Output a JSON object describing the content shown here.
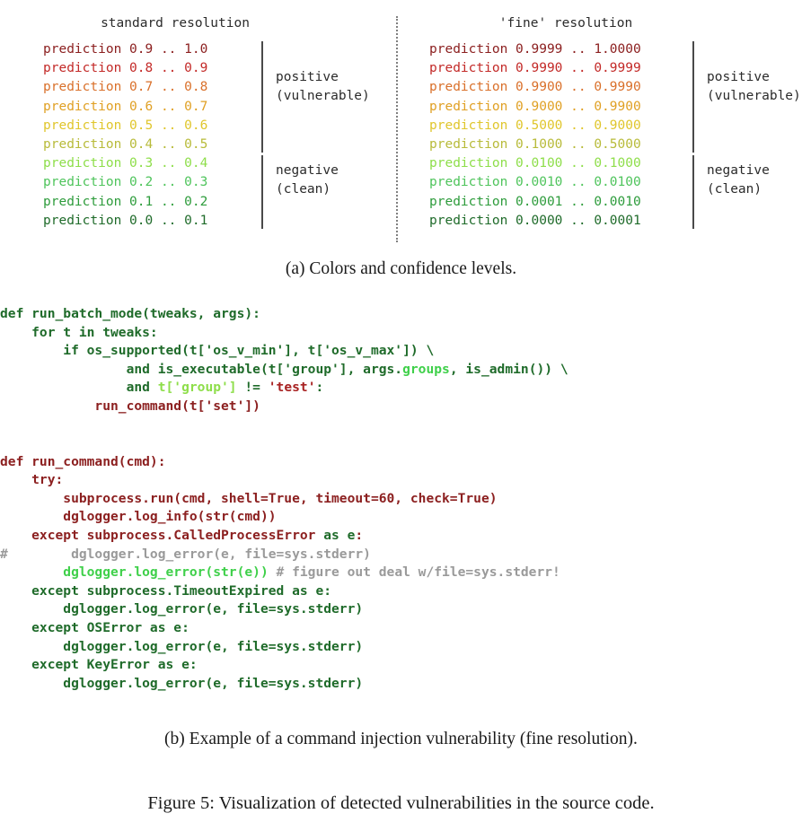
{
  "figure": {
    "caption_a": "(a) Colors and confidence levels.",
    "caption_b": "(b) Example of a command injection vulnerability (fine resolution).",
    "caption_figure": "Figure 5: Visualization of detected vulnerabilities in the source code."
  },
  "legend": {
    "standard": {
      "title": "standard resolution",
      "rows": [
        {
          "text": "prediction 0.9 .. 1.0",
          "color": "#8c2020"
        },
        {
          "text": "prediction 0.8 .. 0.9",
          "color": "#c32a28"
        },
        {
          "text": "prediction 0.7 .. 0.8",
          "color": "#d9702a"
        },
        {
          "text": "prediction 0.6 .. 0.7",
          "color": "#e0a024"
        },
        {
          "text": "prediction 0.5 .. 0.6",
          "color": "#e0c62c"
        },
        {
          "text": "prediction 0.4 .. 0.5",
          "color": "#b8bb3a"
        },
        {
          "text": "prediction 0.3 .. 0.4",
          "color": "#8ede4a"
        },
        {
          "text": "prediction 0.2 .. 0.3",
          "color": "#4fc45c"
        },
        {
          "text": "prediction 0.1 .. 0.2",
          "color": "#2e9c3c"
        },
        {
          "text": "prediction 0.0 .. 0.1",
          "color": "#1f6b2a"
        }
      ],
      "groups": [
        {
          "label_line1": "positive",
          "label_line2": "(vulnerable)"
        },
        {
          "label_line1": "negative",
          "label_line2": "(clean)"
        }
      ]
    },
    "fine": {
      "title": "'fine' resolution",
      "rows": [
        {
          "text": "prediction 0.9999 .. 1.0000",
          "color": "#8c2020"
        },
        {
          "text": "prediction 0.9990 .. 0.9999",
          "color": "#c32a28"
        },
        {
          "text": "prediction 0.9900 .. 0.9990",
          "color": "#d9702a"
        },
        {
          "text": "prediction 0.9000 .. 0.9900",
          "color": "#e0a024"
        },
        {
          "text": "prediction 0.5000 .. 0.9000",
          "color": "#e0c62c"
        },
        {
          "text": "prediction 0.1000 .. 0.5000",
          "color": "#b8bb3a"
        },
        {
          "text": "prediction 0.0100 .. 0.1000",
          "color": "#8ede4a"
        },
        {
          "text": "prediction 0.0010 .. 0.0100",
          "color": "#4fc45c"
        },
        {
          "text": "prediction 0.0001 .. 0.0010",
          "color": "#2e9c3c"
        },
        {
          "text": "prediction 0.0000 .. 0.0001",
          "color": "#1f6b2a"
        }
      ],
      "groups": [
        {
          "label_line1": "positive",
          "label_line2": "(vulnerable)"
        },
        {
          "label_line1": "negative",
          "label_line2": "(clean)"
        }
      ]
    }
  },
  "code": {
    "colors": {
      "clean_dark_green": "#1f6b2a",
      "clean_bright_green": "#3fd04a",
      "clean_light_green": "#8ede4a",
      "vulnerable_dark_red": "#8c2020",
      "vulnerable_red": "#a82222",
      "comment_gray": "#9a9a9a"
    },
    "block1": [
      [
        {
          "t": "def run_batch_mode(tweaks, args):",
          "c": "#1f6b2a"
        }
      ],
      [
        {
          "t": "    for t in tweaks:",
          "c": "#1f6b2a"
        }
      ],
      [
        {
          "t": "        if os_supported(t['os_v_min'], t['os_v_max']) \\",
          "c": "#1f6b2a"
        }
      ],
      [
        {
          "t": "                and is_executable(t['group'], args.",
          "c": "#1f6b2a"
        },
        {
          "t": "groups",
          "c": "#3fd04a"
        },
        {
          "t": ", is_admin()) \\",
          "c": "#1f6b2a"
        }
      ],
      [
        {
          "t": "                and ",
          "c": "#1f6b2a"
        },
        {
          "t": "t['group']",
          "c": "#8ede4a"
        },
        {
          "t": " != ",
          "c": "#1f6b2a"
        },
        {
          "t": "'test'",
          "c": "#a82222"
        },
        {
          "t": ":",
          "c": "#1f6b2a"
        }
      ],
      [
        {
          "t": "            run_command(t['set'])",
          "c": "#8c2020"
        }
      ]
    ],
    "block2": [
      [
        {
          "t": "def run_command(cmd):",
          "c": "#8c2020"
        }
      ],
      [
        {
          "t": "    try:",
          "c": "#8c2020"
        }
      ],
      [
        {
          "t": "        subprocess.run(cmd, shell=True, timeout=60, check=True)",
          "c": "#8c2020"
        }
      ],
      [
        {
          "t": "        dglogger.log_info(str(cmd))",
          "c": "#8c2020"
        }
      ],
      [
        {
          "t": "    except subprocess.CalledProcessError ",
          "c": "#8c2020"
        },
        {
          "t": "as e",
          "c": "#1f6b2a"
        },
        {
          "t": ":",
          "c": "#8c2020"
        }
      ],
      [
        {
          "t": "#        dglogger.log_error(e, file=sys.stderr)",
          "c": "#9a9a9a"
        }
      ],
      [
        {
          "t": "        dglogger.log_error(str(e))",
          "c": "#3fd04a"
        },
        {
          "t": " # figure out deal w/file=sys.stderr!",
          "c": "#9a9a9a"
        }
      ],
      [
        {
          "t": "    except subprocess.TimeoutExpired as e:",
          "c": "#1f6b2a"
        }
      ],
      [
        {
          "t": "        dglogger.log_error(e, file=sys.stderr)",
          "c": "#1f6b2a"
        }
      ],
      [
        {
          "t": "    except OSError as e:",
          "c": "#1f6b2a"
        }
      ],
      [
        {
          "t": "        dglogger.log_error(e, file=sys.stderr)",
          "c": "#1f6b2a"
        }
      ],
      [
        {
          "t": "    except KeyError as e:",
          "c": "#1f6b2a"
        }
      ],
      [
        {
          "t": "        dglogger.log_error(e, file=sys.stderr)",
          "c": "#1f6b2a"
        }
      ]
    ]
  }
}
